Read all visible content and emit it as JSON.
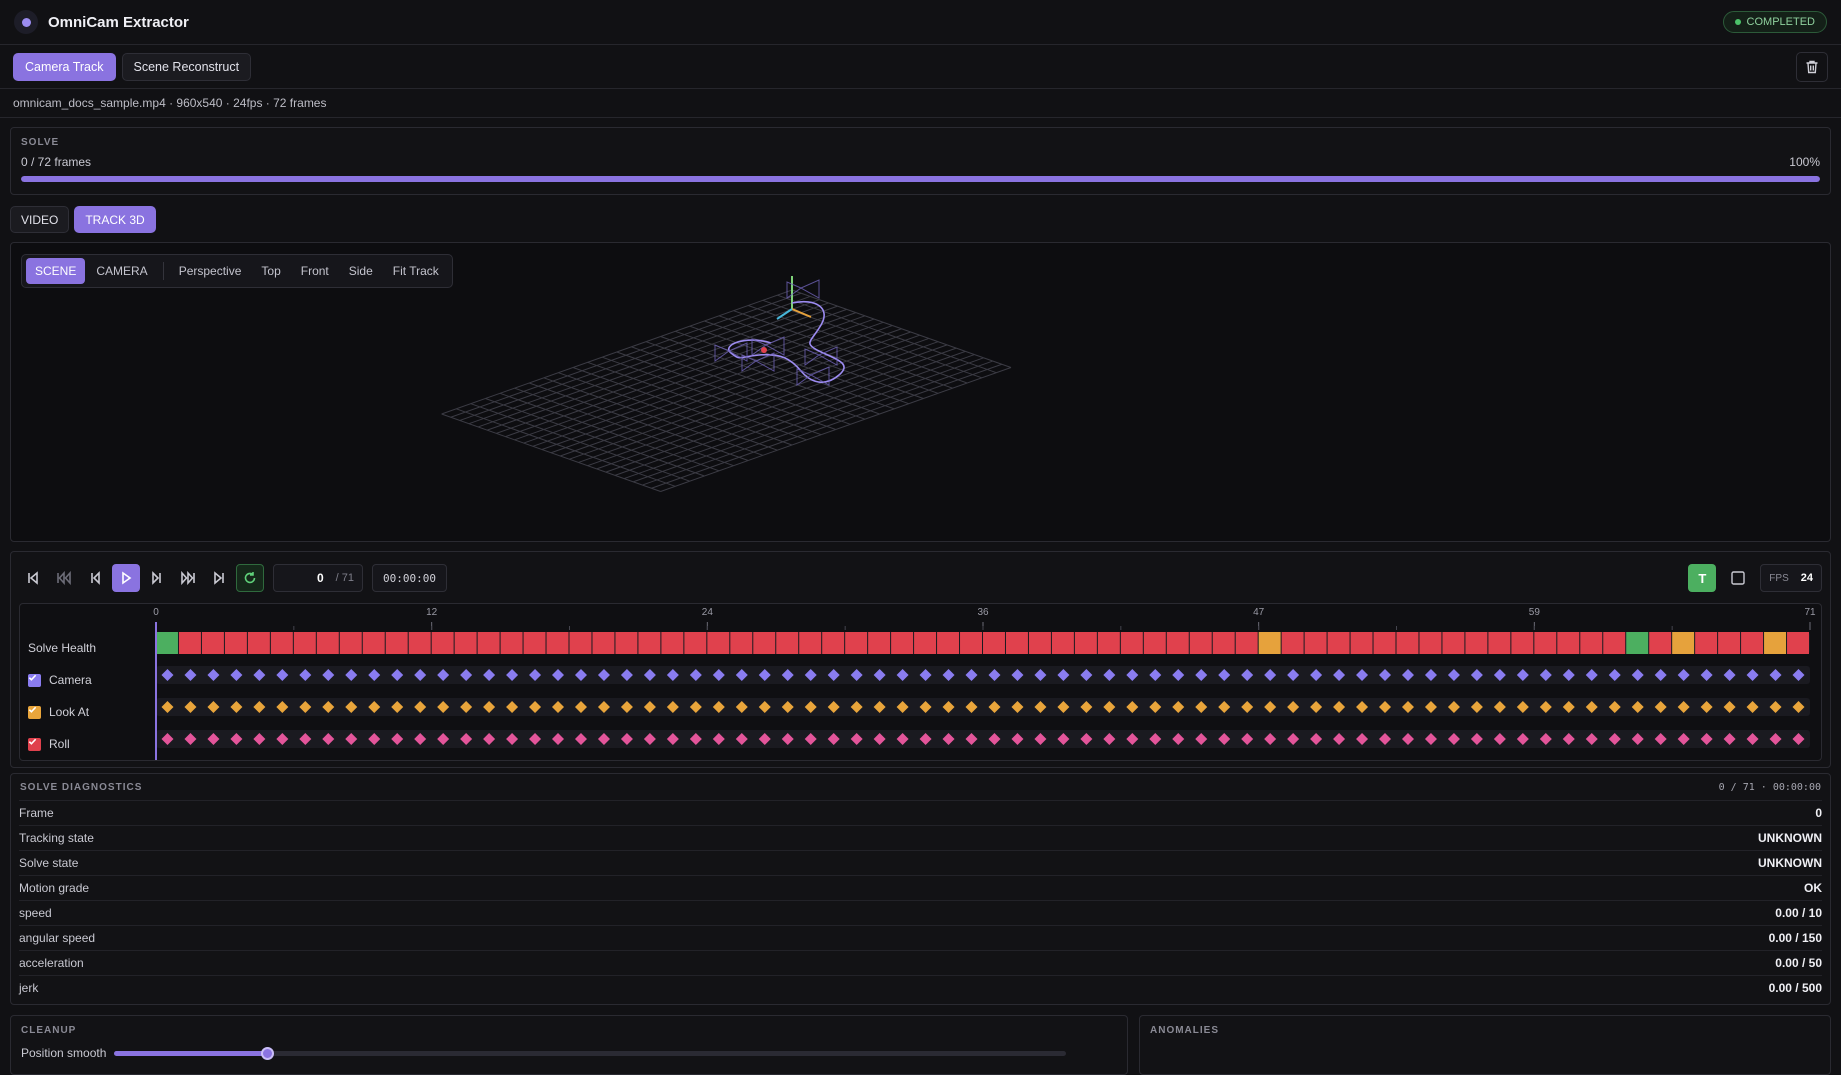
{
  "app": {
    "title": "OmniCam Extractor",
    "status": "COMPLETED"
  },
  "mode_tabs": [
    {
      "label": "Camera Track",
      "active": true
    },
    {
      "label": "Scene Reconstruct",
      "active": false
    }
  ],
  "file_info": "omnicam_docs_sample.mp4 · 960x540 · 24fps · 72 frames",
  "solve": {
    "label": "SOLVE",
    "frames_text": "0 / 72 frames",
    "percent_text": "100%",
    "progress": 1.0
  },
  "view_tabs": [
    {
      "label": "VIDEO",
      "active": false
    },
    {
      "label": "TRACK 3D",
      "active": true
    }
  ],
  "viewport_toolbar": {
    "modes": [
      {
        "label": "SCENE",
        "active": true
      },
      {
        "label": "CAMERA",
        "active": false
      }
    ],
    "views": [
      "Perspective",
      "Top",
      "Front",
      "Side",
      "Fit Track"
    ]
  },
  "playback": {
    "frame": "0",
    "total": "/ 71",
    "timecode": "00:00:00",
    "fps_label": "FPS",
    "fps": "24",
    "t_label": "T"
  },
  "timeline": {
    "frame_count": 72,
    "ticks": [
      {
        "frame": 0,
        "label": "0"
      },
      {
        "frame": 12,
        "label": "12"
      },
      {
        "frame": 24,
        "label": "24"
      },
      {
        "frame": 36,
        "label": "36"
      },
      {
        "frame": 48,
        "label": "47"
      },
      {
        "frame": 60,
        "label": "59"
      },
      {
        "frame": 72,
        "label": "71"
      }
    ],
    "tracks": [
      {
        "label": "Solve Health"
      },
      {
        "label": "Camera",
        "checked": true,
        "color": "#8a7cf0"
      },
      {
        "label": "Look At",
        "checked": true,
        "color": "#e9a53b"
      },
      {
        "label": "Roll",
        "checked": true,
        "color": "#e3559a"
      }
    ],
    "health_colors": {
      "bad": "#e0414d",
      "warn": "#e6a23c",
      "good": "#4caf60"
    },
    "health": [
      "good",
      "bad",
      "bad",
      "bad",
      "bad",
      "bad",
      "bad",
      "bad",
      "bad",
      "bad",
      "bad",
      "bad",
      "bad",
      "bad",
      "bad",
      "bad",
      "bad",
      "bad",
      "bad",
      "bad",
      "bad",
      "bad",
      "bad",
      "bad",
      "bad",
      "bad",
      "bad",
      "bad",
      "bad",
      "bad",
      "bad",
      "bad",
      "bad",
      "bad",
      "bad",
      "bad",
      "bad",
      "bad",
      "bad",
      "bad",
      "bad",
      "bad",
      "bad",
      "bad",
      "bad",
      "bad",
      "bad",
      "bad",
      "warn",
      "bad",
      "bad",
      "bad",
      "bad",
      "bad",
      "bad",
      "bad",
      "bad",
      "bad",
      "bad",
      "bad",
      "bad",
      "bad",
      "bad",
      "bad",
      "good",
      "bad",
      "warn",
      "bad",
      "bad",
      "bad",
      "warn",
      "bad"
    ]
  },
  "diagnostics": {
    "label": "SOLVE DIAGNOSTICS",
    "position": "0 / 71 · 00:00:00",
    "rows": [
      {
        "label": "Frame",
        "value": "0"
      },
      {
        "label": "Tracking state",
        "value": "UNKNOWN"
      },
      {
        "label": "Solve state",
        "value": "UNKNOWN"
      },
      {
        "label": "Motion grade",
        "value": "OK"
      },
      {
        "label": "speed",
        "value": "0.00 / 10"
      },
      {
        "label": "angular speed",
        "value": "0.00 / 150"
      },
      {
        "label": "acceleration",
        "value": "0.00 / 50"
      },
      {
        "label": "jerk",
        "value": "0.00 / 500"
      }
    ]
  },
  "cleanup": {
    "label": "CLEANUP",
    "position_smooth_label": "Position smooth",
    "position_smooth_value": 0.16
  },
  "anomalies": {
    "label": "ANOMALIES"
  },
  "colors": {
    "accent": "#8a73e0",
    "success": "#4caf60"
  }
}
